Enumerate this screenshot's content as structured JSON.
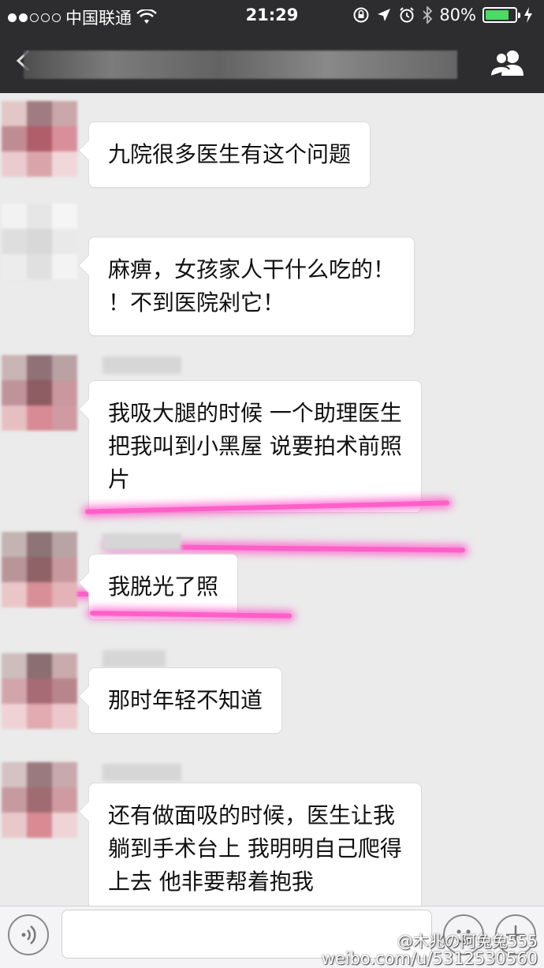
{
  "status_bar": {
    "carrier": "中国联通",
    "time": "21:29",
    "battery": "80%",
    "battery_level": 0.8
  },
  "chat_messages": [
    {
      "text": "九院很多医生有这个问题"
    },
    {
      "text": "麻痹，女孩家人干什么吃的！\n！不到医院剁它！"
    },
    {
      "text": "我吸大腿的时候 一个助理医生\n把我叫到小黑屋 说要拍术前照\n片"
    },
    {
      "text": "我脱光了照"
    },
    {
      "text": "那时年轻不知道"
    },
    {
      "text": "还有做面吸的时候，医生让我\n躺到手术台上 我明明自己爬得\n上去 他非要帮着抱我"
    }
  ],
  "watermark": {
    "handle": "@木兆の阿兔兔555",
    "url": "weibo.com/u/5312530560"
  },
  "colors": {
    "bar_bg": "#2d2d2f",
    "chat_bg": "#ebebeb",
    "highlight": "#ff5fc8",
    "battery_fill": "#4cd964"
  }
}
